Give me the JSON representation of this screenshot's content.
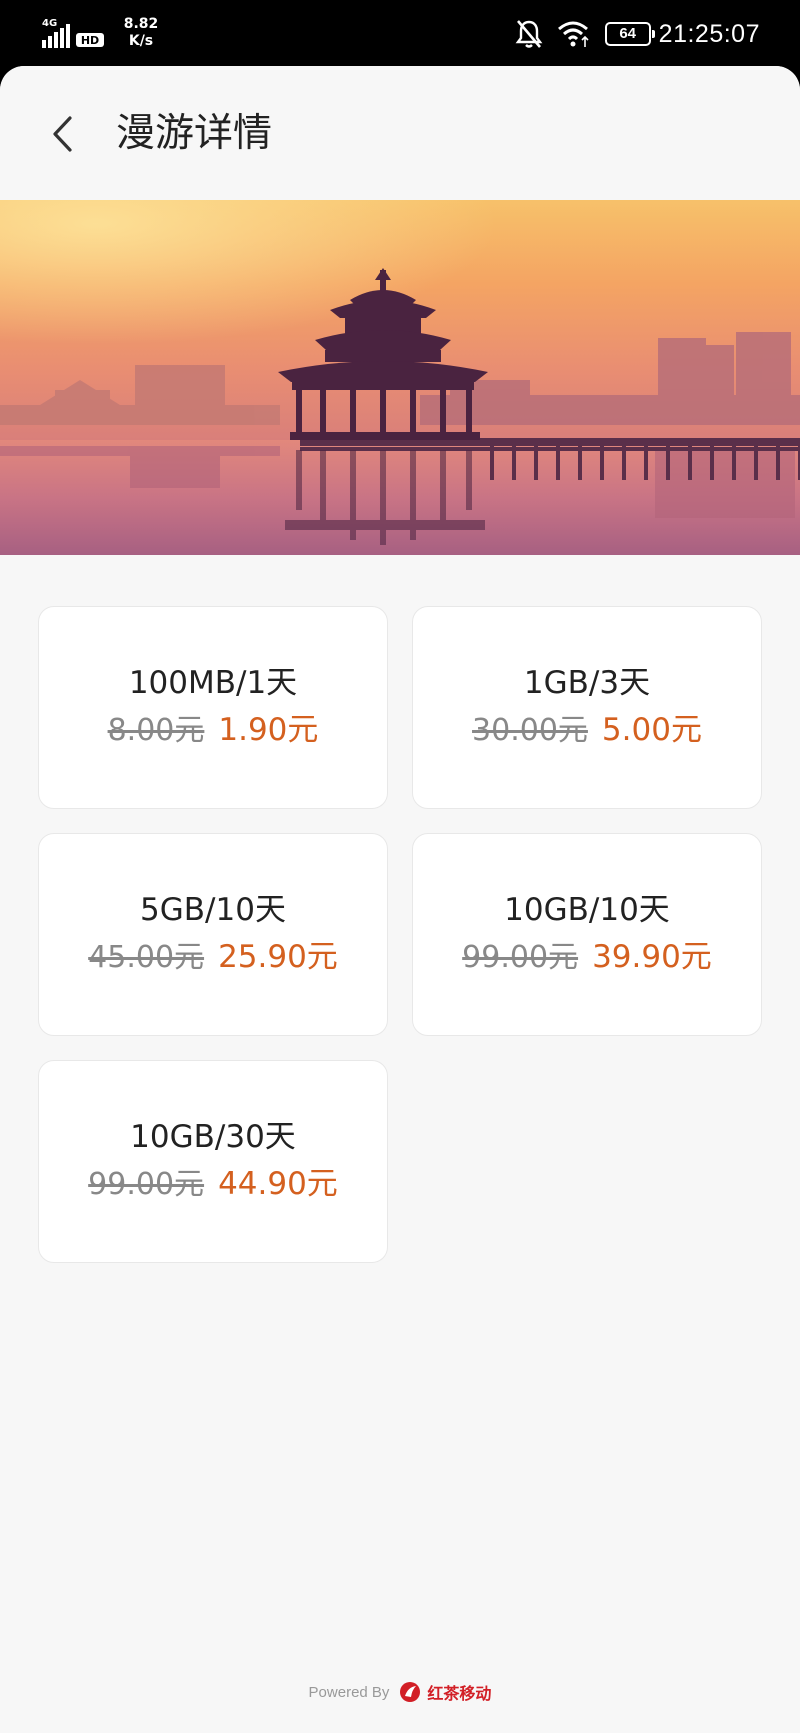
{
  "status_bar": {
    "network": "4G",
    "hd": "HD",
    "speed_value": "8.82",
    "speed_unit": "K/s",
    "battery": "64",
    "time": "21:25:07",
    "icons": [
      "signal-icon",
      "hd-icon",
      "bell-muted-icon",
      "wifi-icon",
      "battery-icon"
    ]
  },
  "header": {
    "title": "漫游详情",
    "back_icon": "chevron-left-icon"
  },
  "banner": {
    "image": "pavilion-lake-sunset-photo"
  },
  "plans": [
    {
      "name": "100MB/1天",
      "original_price": "8.00元",
      "price": "1.90元"
    },
    {
      "name": "1GB/3天",
      "original_price": "30.00元",
      "price": "5.00元"
    },
    {
      "name": "5GB/10天",
      "original_price": "45.00元",
      "price": "25.90元"
    },
    {
      "name": "10GB/10天",
      "original_price": "99.00元",
      "price": "39.90元"
    },
    {
      "name": "10GB/30天",
      "original_price": "99.00元",
      "price": "44.90元"
    }
  ],
  "footer": {
    "powered_by": "Powered By",
    "brand": "红茶移动",
    "brand_icon": "hongcha-logo-icon"
  },
  "colors": {
    "accent_price": "#d4601f",
    "brand_red": "#d21f26",
    "background": "#f7f7f7"
  }
}
